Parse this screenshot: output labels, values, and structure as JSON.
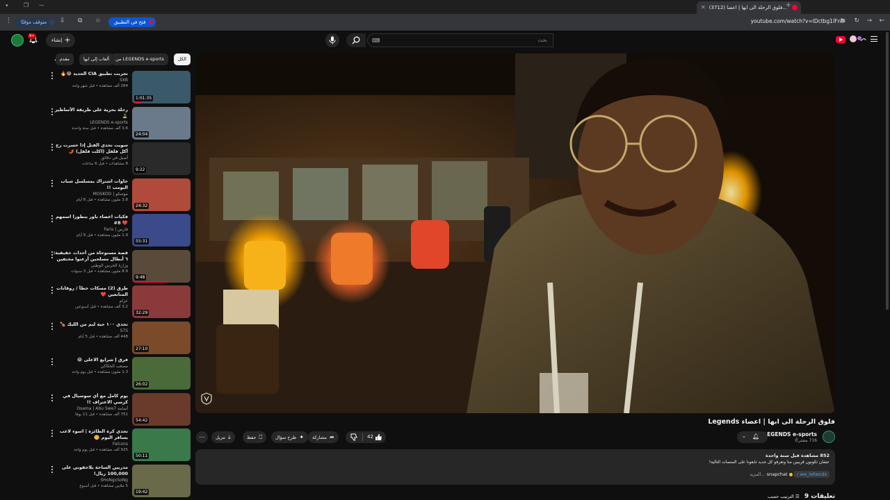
{
  "browser": {
    "tab_title": "(3712) فلوق الرحلة الى ابها | اعضا...",
    "url": "youtube.com/watch?v=lDctbg1IFn8",
    "open_in_app": "فتح في التطبيق",
    "paused": "متوقف مؤقتًا"
  },
  "header": {
    "search_placeholder": "بحث",
    "create_label": "إنشاء",
    "notifications_count": "9+"
  },
  "chips": [
    "الكل",
    "من LEGENDS e-sports",
    "ألعاب إلى ابها",
    "مقدم"
  ],
  "recommendations": [
    {
      "title": "تجربت تطبيق CIA الجديد 😂🔥",
      "channel": "SXB",
      "stats": "284 ألف مشاهدة • قبل شهر واحد",
      "duration": "1:01:35",
      "progress": 0.15
    },
    {
      "title": "رحلة بحرية على طريقة الأساطير 🏝️",
      "channel": "LEGENDS e-sports",
      "stats": "3.6 ألف مشاهدة • قبل سنة واحدة",
      "duration": "24:04",
      "progress": 0
    },
    {
      "title": "سويت تحدي القتل إذا خسرت رح آكل فلفل (اكلت فلفل) 🌶️",
      "channel": "أصيل في دقائق",
      "stats": "8 مشاهدات • قبل 6 ساعات",
      "duration": "9:22",
      "progress": 0
    },
    {
      "title": "خاوات اشتراك بمسلسل شباب البومب !!",
      "channel": "موسكو | MOSKOO",
      "stats": "3.8 مليون مشاهدة • قبل 8 أيام",
      "duration": "24:32",
      "progress": 0
    },
    {
      "title": "فكيات اعضاء باور بنطورا اسمهم ❤️ 8#",
      "channel": "فارس | Faris",
      "stats": "1.9 مليون مشاهدة • قبل 9 أيام",
      "duration": "55:31",
      "progress": 0
    },
    {
      "title": "قصة مستوحاة من أحداث حقيقية: ٦ أبطال مسلحين أرعبوا مختفين في يوم ٣ تشرين/حرب...",
      "channel": "وزارة الحرس الوطني",
      "stats": "8.9 مليون مشاهدة • قبل 3 سنوات",
      "duration": "9:48",
      "progress": 0.6
    },
    {
      "title": "طرق (2) مسكات خطأ / روقانات المتابعين ❤️",
      "channel": "عزام",
      "stats": "3.2 ألف مشاهدة • قبل أسبوعين",
      "duration": "32:29",
      "progress": 0
    },
    {
      "title": "تحدي ١٠٠ حبة ليم من الليك 🍗",
      "channel": "S7S",
      "stats": "448 ألف مشاهدة • قبل 5 أيام",
      "duration": "27:10",
      "progress": 0
    },
    {
      "title": "فرق إ شرايع الاعلى 😂",
      "channel": "مصعب الحكاكي",
      "stats": "1.3 مليون مشاهدة • قبل يوم واحد",
      "duration": "26:02",
      "progress": 0
    },
    {
      "title": "يوم كامل مع أي سوسيال في كرسي الاعتراف !!",
      "channel": "أسامة Osama | Abu Swe7",
      "stats": "751 ألف مشاهدة • قبل 11 يومًا",
      "duration": "54:42",
      "progress": 0
    },
    {
      "title": "تحدي كرة الطائرة | اسوء لاعب يسافر اليوم 🤫",
      "channel": "Falcons",
      "stats": "925 ألف مشاهدة • قبل يوم واحد",
      "duration": "50:11",
      "progress": 0
    },
    {
      "title": "مدربين الساحة يلاحقوني على 100,000 ريال!",
      "channel": "SHoNgxSoNg",
      "stats": "5 ملايين مشاهدة • قبل أسبوع",
      "duration": "19:42",
      "progress": 0
    }
  ],
  "video": {
    "title": "فلوق الرحلة الى ابها | اعضاء Legends",
    "channel": "LEGENDS e-sports",
    "subscribers": "716 مشتركًا",
    "likes": "42",
    "share": "مشاركة",
    "ask": "طرح سؤال",
    "save": "حفظ",
    "download": "تنزيل"
  },
  "description": {
    "stats": "852 مشاهدة  قبل سنة واحدة",
    "text": "عشان تكونون قريبين منا وتعرفو كل جديد تابعونا على المنصات التالية!",
    "link_prefix": "snapchat",
    "link": "we_leltends",
    "more": "...المزيد"
  },
  "comments": {
    "label": "9 تعليقات",
    "sort": "الترتيب حسب"
  },
  "colors": {
    "accent": "#ff0033",
    "background": "#0f0f0f",
    "surface": "#272727"
  }
}
